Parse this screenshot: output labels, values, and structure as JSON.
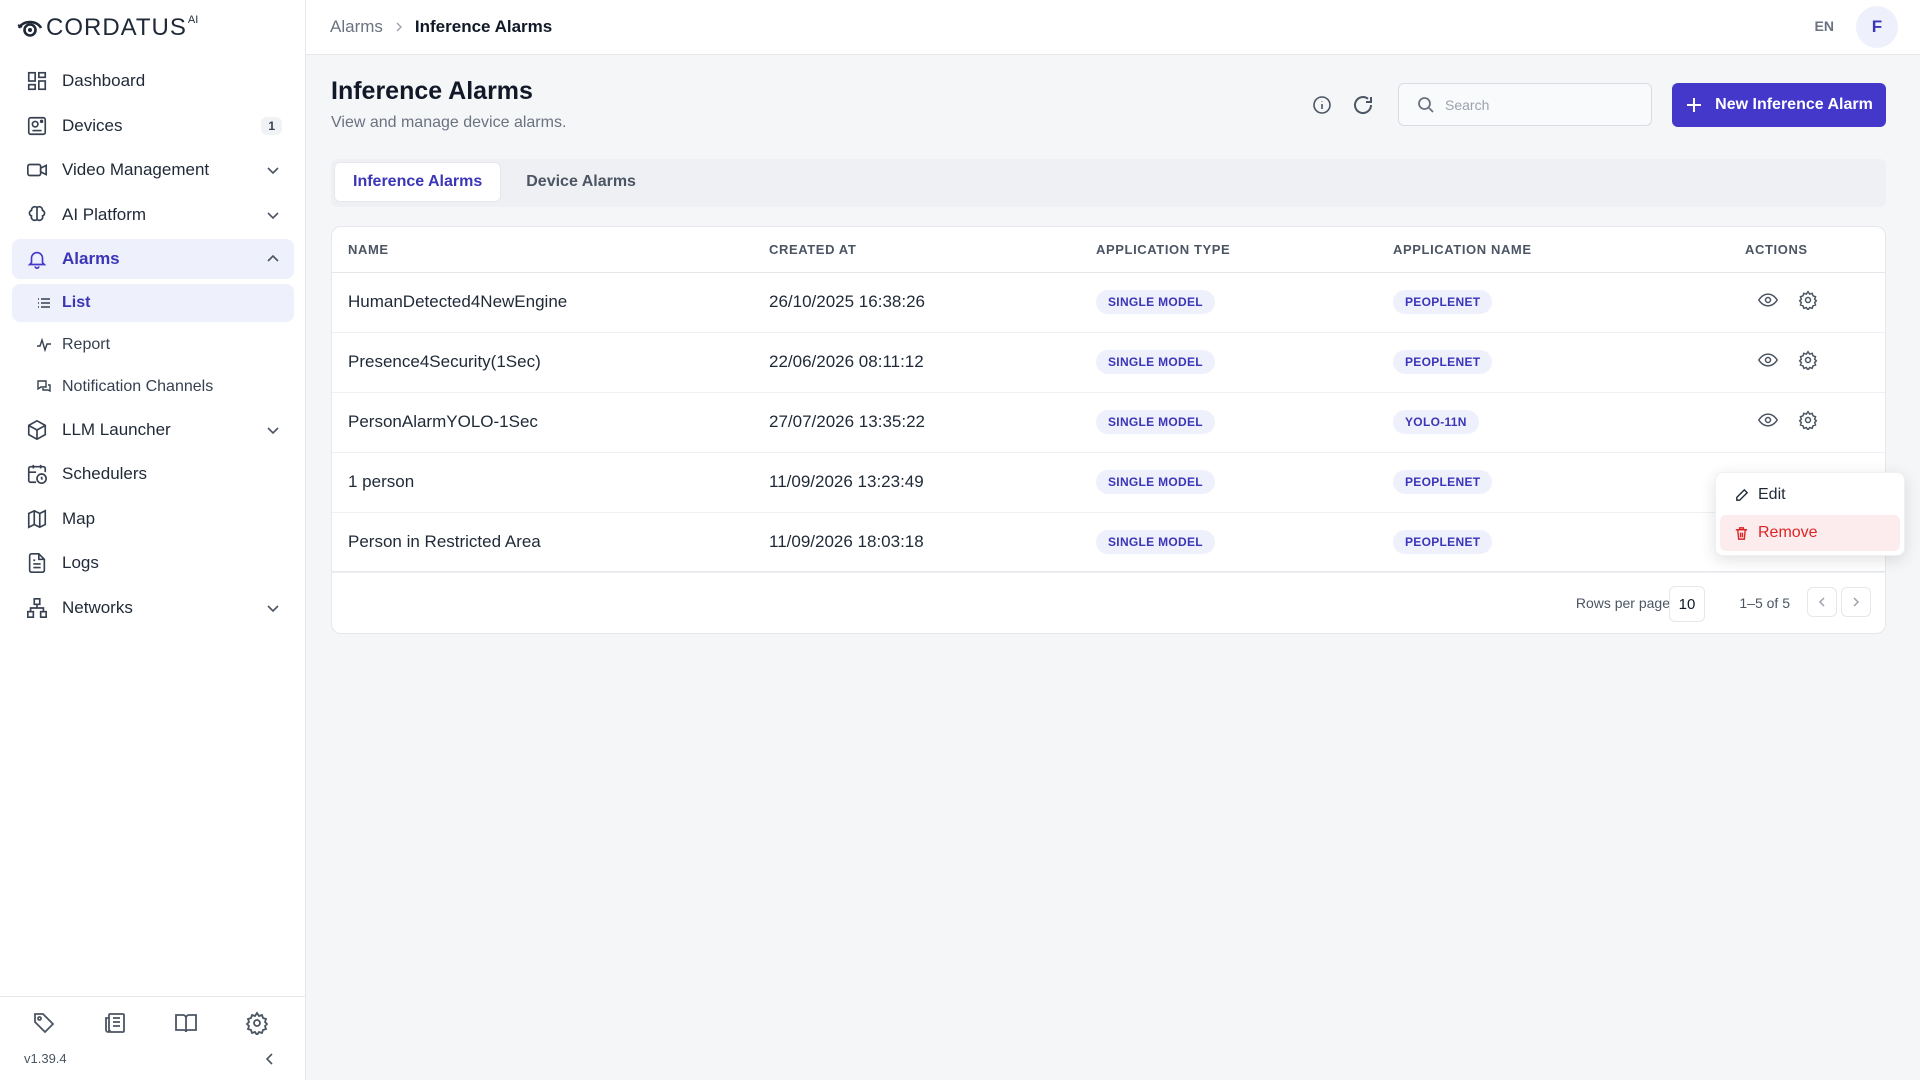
{
  "brand": {
    "name": "CORDATUS",
    "suffix": "AI"
  },
  "sidebar": {
    "items": [
      {
        "label": "Dashboard"
      },
      {
        "label": "Devices",
        "badge": "1"
      },
      {
        "label": "Video Management"
      },
      {
        "label": "AI Platform"
      },
      {
        "label": "Alarms"
      },
      {
        "label": "LLM Launcher"
      },
      {
        "label": "Schedulers"
      },
      {
        "label": "Map"
      },
      {
        "label": "Logs"
      },
      {
        "label": "Networks"
      }
    ],
    "alarm_sub": [
      {
        "label": "List"
      },
      {
        "label": "Report"
      },
      {
        "label": "Notification Channels"
      }
    ],
    "version": "v1.39.4"
  },
  "header": {
    "breadcrumb": [
      "Alarms",
      "Inference Alarms"
    ],
    "lang": "EN",
    "avatar": "F"
  },
  "main": {
    "title": "Inference Alarms",
    "subtitle": "View and manage device alarms.",
    "search_placeholder": "Search",
    "new_button": "New Inference Alarm",
    "tabs": [
      "Inference Alarms",
      "Device Alarms"
    ],
    "columns": [
      "NAME",
      "CREATED AT",
      "APPLICATION TYPE",
      "APPLICATION NAME",
      "ACTIONS"
    ],
    "rows": [
      {
        "name": "HumanDetected4NewEngine",
        "created": "26/10/2025 16:38:26",
        "type": "SINGLE MODEL",
        "app": "PEOPLENET"
      },
      {
        "name": "Presence4Security(1Sec)",
        "created": "22/06/2026 08:11:12",
        "type": "SINGLE MODEL",
        "app": "PEOPLENET"
      },
      {
        "name": "PersonAlarmYOLO-1Sec",
        "created": "27/07/2026 13:35:22",
        "type": "SINGLE MODEL",
        "app": "YOLO-11N"
      },
      {
        "name": "1 person",
        "created": "11/09/2026 13:23:49",
        "type": "SINGLE MODEL",
        "app": "PEOPLENET"
      },
      {
        "name": "Person in Restricted Area",
        "created": "11/09/2026 18:03:18",
        "type": "SINGLE MODEL",
        "app": "PEOPLENET"
      }
    ],
    "pager": {
      "rows_label": "Rows per page",
      "rows_value": "10",
      "range": "1–5 of 5"
    },
    "context_menu": {
      "edit": "Edit",
      "remove": "Remove"
    }
  },
  "colors": {
    "accent": "#4338ca",
    "danger": "#dc2626"
  }
}
